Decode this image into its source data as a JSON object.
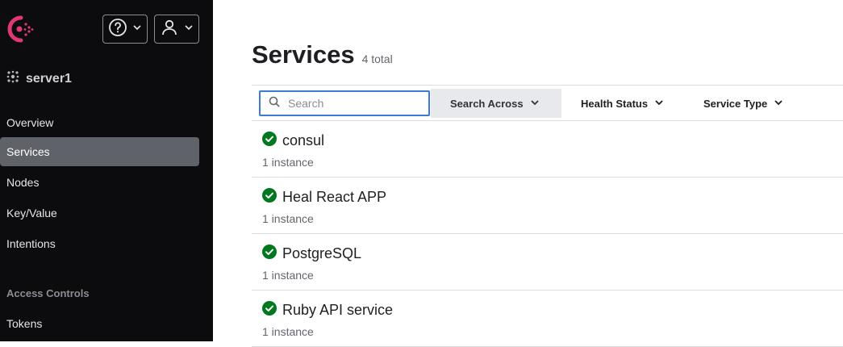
{
  "header": {
    "logo_icon": "consul-logo-icon",
    "help_icon": "help-circle-icon",
    "user_icon": "user-icon"
  },
  "datacenter": {
    "name": "server1",
    "icon": "cluster-icon"
  },
  "nav": {
    "items": [
      {
        "label": "Overview"
      },
      {
        "label": "Services"
      },
      {
        "label": "Nodes"
      },
      {
        "label": "Key/Value"
      },
      {
        "label": "Intentions"
      }
    ],
    "access_heading": "Access Controls",
    "access_items": [
      {
        "label": "Tokens"
      }
    ]
  },
  "page": {
    "title": "Services",
    "count": "4 total"
  },
  "filters": {
    "search_placeholder": "Search",
    "search_value": "",
    "search_across": "Search Across",
    "health_status": "Health Status",
    "service_type": "Service Type"
  },
  "services": [
    {
      "name": "consul",
      "instances": "1 instance",
      "status": "passing"
    },
    {
      "name": "Heal React APP",
      "instances": "1 instance",
      "status": "passing"
    },
    {
      "name": "PostgreSQL",
      "instances": "1 instance",
      "status": "passing"
    },
    {
      "name": "Ruby API service",
      "instances": "1 instance",
      "status": "passing"
    }
  ],
  "colors": {
    "brand": "#e03875",
    "sidebar_bg": "#0c0c0e",
    "active_nav": "#60626a",
    "passing": "#00781e",
    "focus": "#3a7bd5"
  }
}
